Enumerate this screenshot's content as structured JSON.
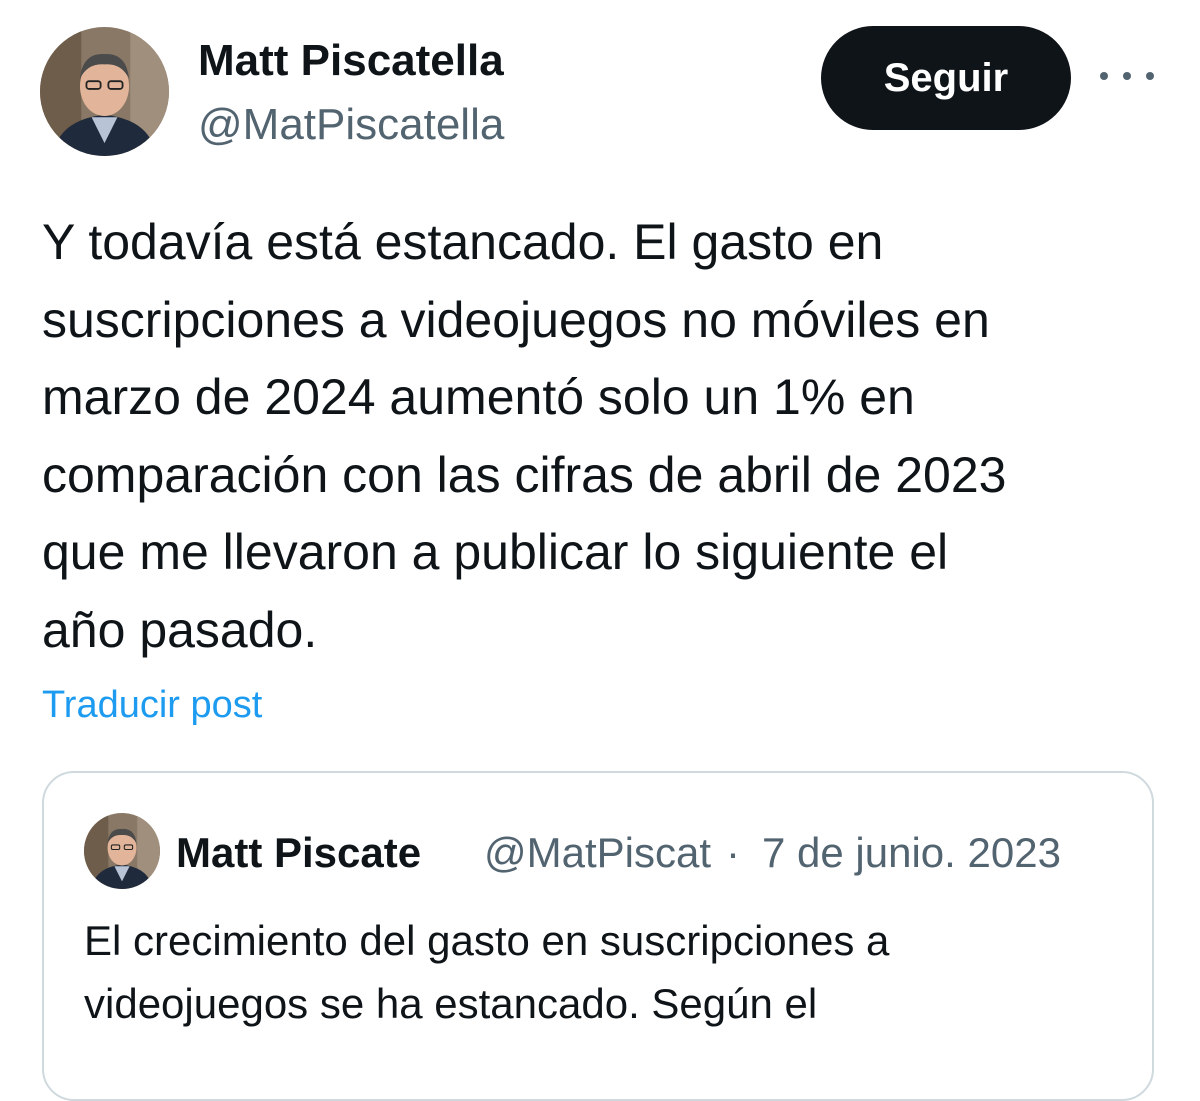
{
  "author": {
    "name": "Matt Piscatella",
    "handle": "@MatPiscatella"
  },
  "actions": {
    "follow_label": "Seguir",
    "more_icon": "more-horizontal-icon"
  },
  "tweet": {
    "lines": [
      "Y todavía está estancado.  El gasto en",
      "suscripciones a videojuegos no móviles en",
      "marzo de 2024 aumentó solo un 1% en",
      "comparación con las cifras de abril de 2023",
      "que me llevaron a publicar lo siguiente el",
      "año pasado."
    ],
    "translate_label": "Traducir post"
  },
  "quoted": {
    "name": "Matt Piscate",
    "handle": "@MatPiscatella",
    "separator": "·",
    "date": "7 de junio. 2023",
    "lines": [
      "El crecimiento del gasto en suscripciones a",
      "videojuegos se ha estancado.  Según el"
    ]
  },
  "colors": {
    "text": "#0f1419",
    "secondary": "#536471",
    "link": "#1d9bf0",
    "button_bg": "#0f1419",
    "border": "#cfd9de"
  }
}
